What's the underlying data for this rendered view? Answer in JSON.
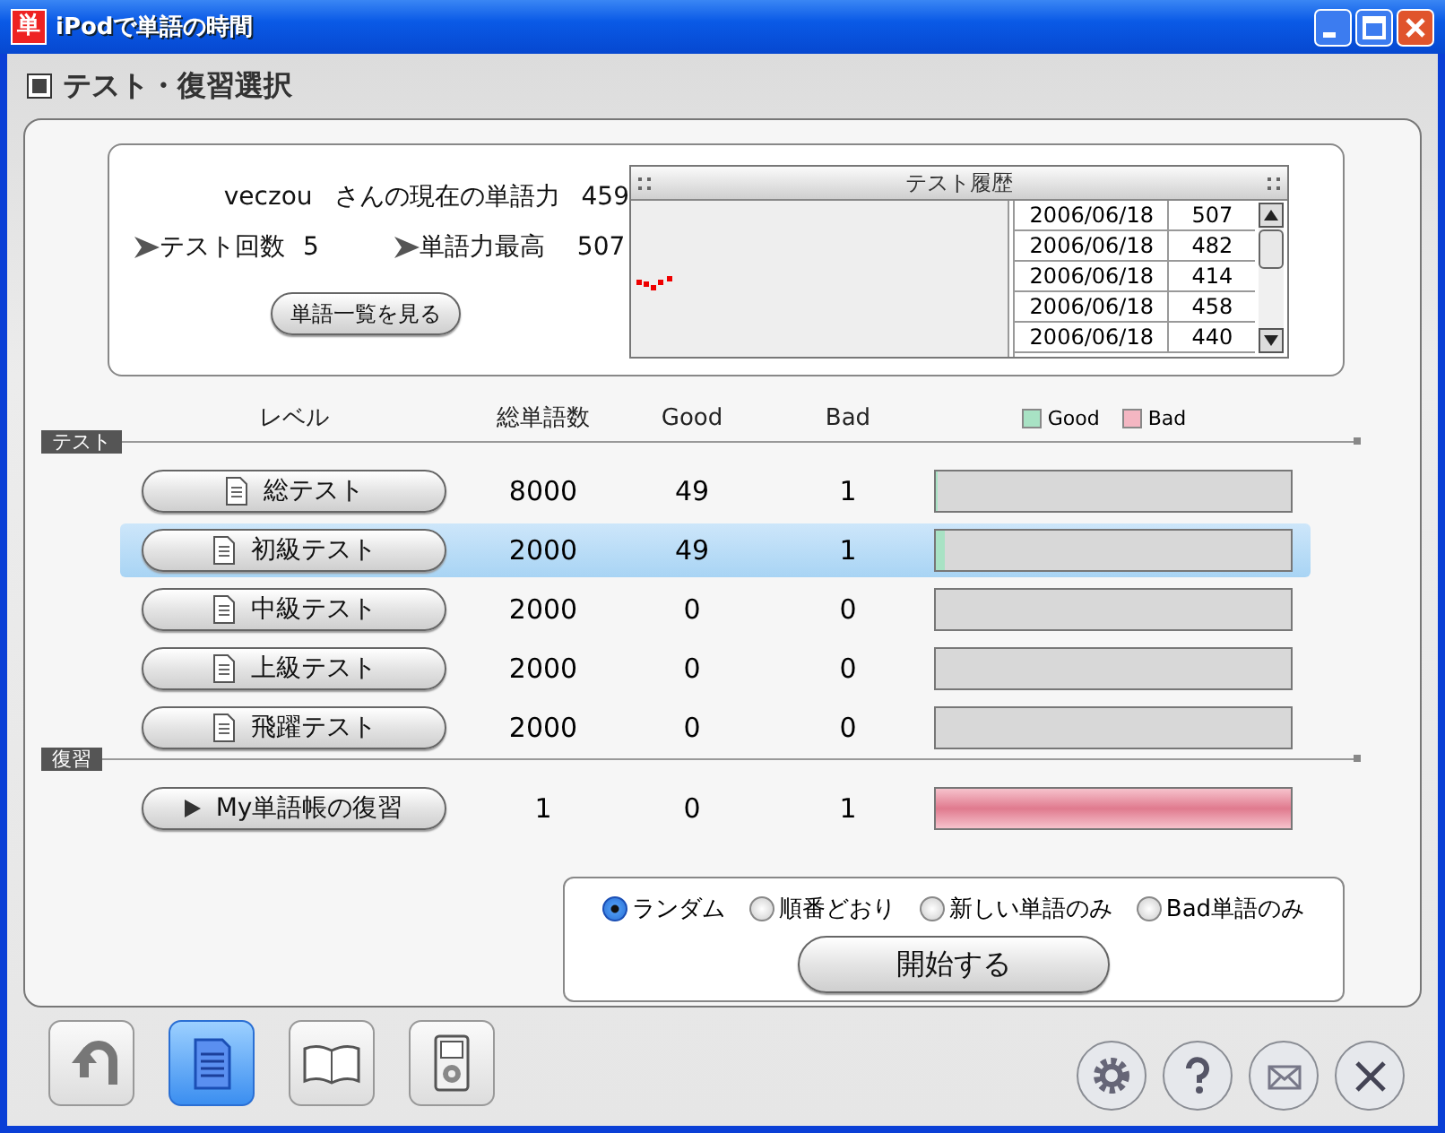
{
  "window": {
    "title": "iPodで単語の時間",
    "app_icon_glyph": "単"
  },
  "page_title": "テスト・復習選択",
  "summary": {
    "user": "veczou",
    "current_label": "さんの現在の単語力",
    "current": "459",
    "tests_label": "テスト回数",
    "tests": "5",
    "best_label": "単語力最高",
    "best": "507",
    "word_list_button": "単語一覧を見る"
  },
  "history": {
    "title": "テスト履歴",
    "rows": [
      {
        "date": "2006/06/18",
        "score": "507"
      },
      {
        "date": "2006/06/18",
        "score": "482"
      },
      {
        "date": "2006/06/18",
        "score": "414"
      },
      {
        "date": "2006/06/18",
        "score": "458"
      },
      {
        "date": "2006/06/18",
        "score": "440"
      }
    ]
  },
  "columns": [
    "レベル",
    "総単語数",
    "Good",
    "Bad"
  ],
  "legend": [
    {
      "label": "Good",
      "color": "#a8e2c4"
    },
    {
      "label": "Bad",
      "color": "#f4b6c2"
    }
  ],
  "sections": [
    {
      "label": "テスト",
      "rows": [
        {
          "kind": "test",
          "name": "総テスト",
          "total": "8000",
          "good": "49",
          "bad": "1",
          "selected": false,
          "good_bar": {
            "level": 0.006
          }
        },
        {
          "kind": "test",
          "name": "初級テスト",
          "total": "2000",
          "good": "49",
          "bad": "1",
          "selected": true,
          "good_bar": {
            "level": 0.025
          }
        },
        {
          "kind": "test",
          "name": "中級テスト",
          "total": "2000",
          "good": "0",
          "bad": "0",
          "selected": false
        },
        {
          "kind": "test",
          "name": "上級テスト",
          "total": "2000",
          "good": "0",
          "bad": "0",
          "selected": false
        },
        {
          "kind": "test",
          "name": "飛躍テスト",
          "total": "2000",
          "good": "0",
          "bad": "0",
          "selected": false
        }
      ]
    },
    {
      "label": "復習",
      "rows": [
        {
          "kind": "review",
          "name": "My単語帳の復習",
          "total": "1",
          "good": "0",
          "bad": "1",
          "selected": false,
          "bad_bar": {
            "level": 1.0
          }
        }
      ]
    }
  ],
  "order_options": [
    {
      "label": "ランダム",
      "selected": true
    },
    {
      "label": "順番どおり",
      "selected": false
    },
    {
      "label": "新しい単語のみ",
      "selected": false
    },
    {
      "label": "Bad単語のみ",
      "selected": false
    }
  ],
  "start_button": "開始する",
  "toolbar": [
    {
      "kind": "back",
      "selected": false
    },
    {
      "kind": "document",
      "selected": true
    },
    {
      "kind": "book",
      "selected": false
    },
    {
      "kind": "player",
      "selected": false
    }
  ],
  "actions": [
    {
      "kind": "settings"
    },
    {
      "kind": "help"
    },
    {
      "kind": "mail"
    },
    {
      "kind": "close"
    }
  ]
}
